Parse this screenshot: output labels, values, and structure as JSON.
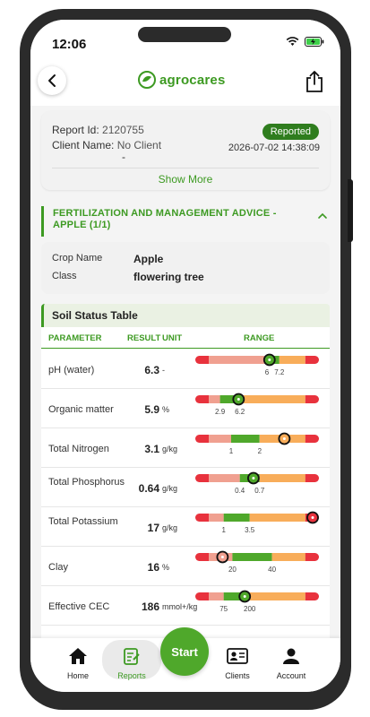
{
  "status_bar": {
    "time": "12:06"
  },
  "header": {
    "brand": "agrocares"
  },
  "report": {
    "id_label": "Report Id:",
    "id_value": "2120755",
    "client_label": "Client Name:",
    "client_value": "No Client",
    "client_value_2": "-",
    "status": "Reported",
    "datetime": "2026-07-02 14:38:09",
    "show_more": "Show More"
  },
  "advice": {
    "title": "FERTILIZATION AND MANAGEMENT ADVICE - APPLE (1/1)",
    "crop_label": "Crop Name",
    "crop_value": "Apple",
    "class_label": "Class",
    "class_value": "flowering tree"
  },
  "soil_table": {
    "title": "Soil Status Table",
    "headers": {
      "parameter": "PARAMETER",
      "result": "RESULT",
      "unit": "UNIT",
      "range": "RANGE"
    },
    "rows": [
      {
        "parameter": "pH (water)",
        "result": "6.3",
        "unit": "-",
        "low": "6",
        "high": "7.2",
        "position": 0.6,
        "status": "good"
      },
      {
        "parameter": "Organic matter",
        "result": "5.9",
        "unit": "%",
        "low": "2.9",
        "high": "6.2",
        "position": 0.35,
        "status": "good"
      },
      {
        "parameter": "Total Nitrogen",
        "result": "3.1",
        "unit": "g/kg",
        "low": "1",
        "high": "2",
        "position": 0.72,
        "status": "high"
      },
      {
        "parameter": "Total Phosphorus",
        "result": "0.64",
        "unit": "g/kg",
        "low": "0.4",
        "high": "0.7",
        "position": 0.47,
        "status": "good"
      },
      {
        "parameter": "Total Potassium",
        "result": "17",
        "unit": "g/kg",
        "low": "1",
        "high": "3.5",
        "position": 0.96,
        "status": "very-high"
      },
      {
        "parameter": "Clay",
        "result": "16",
        "unit": "%",
        "low": "20",
        "high": "40",
        "position": 0.22,
        "status": "low"
      },
      {
        "parameter": "Effective CEC",
        "result": "186",
        "unit": "mmol+/kg",
        "low": "75",
        "high": "200",
        "position": 0.4,
        "status": "good"
      }
    ]
  },
  "nav": {
    "home": "Home",
    "reports": "Reports",
    "start": "Start",
    "clients": "Clients",
    "account": "Account"
  },
  "colors": {
    "brand_green": "#3d9a22",
    "range_red": "#e8323d",
    "range_salmon": "#f0a090",
    "range_green": "#4fa82b",
    "range_orange": "#f8ad5a"
  }
}
